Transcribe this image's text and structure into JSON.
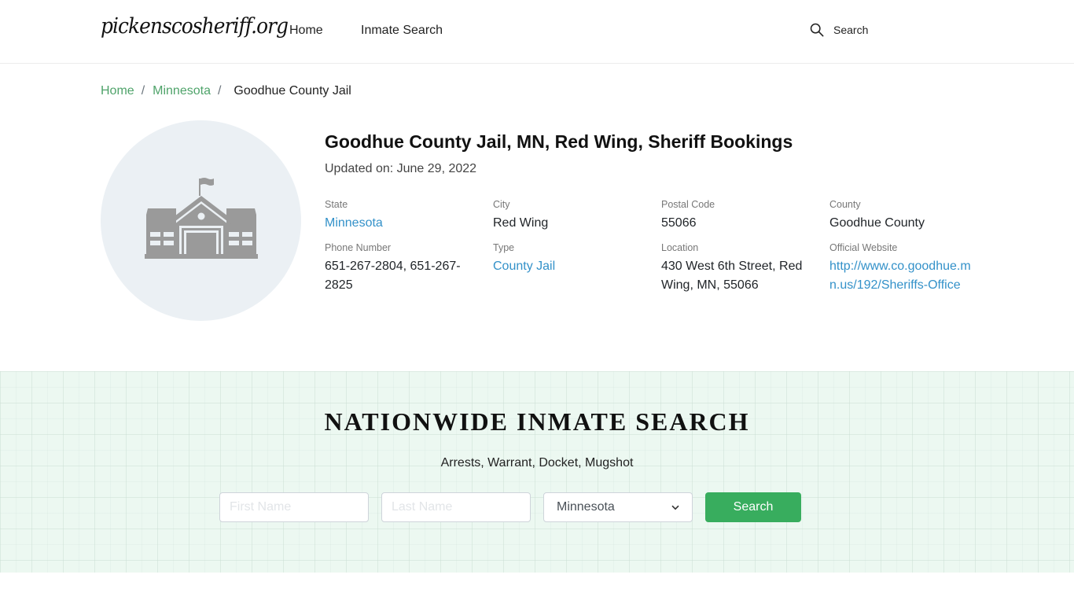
{
  "header": {
    "logo": "pickenscosheriff.org",
    "nav": [
      {
        "label": "Home"
      },
      {
        "label": "Inmate Search"
      }
    ],
    "search_label": "Search",
    "search_icon": "search-icon"
  },
  "breadcrumb": {
    "items": [
      {
        "label": "Home"
      },
      {
        "label": "Minnesota"
      }
    ],
    "separator": "/",
    "current": "Goodhue County Jail"
  },
  "facility": {
    "icon": "building-icon",
    "title": "Goodhue County Jail, MN, Red Wing, Sheriff Bookings",
    "updated": "Updated on: June 29, 2022",
    "fields": [
      {
        "label": "State",
        "value": "Minnesota",
        "is_link": true
      },
      {
        "label": "City",
        "value": "Red Wing",
        "is_link": false
      },
      {
        "label": "Postal Code",
        "value": "55066",
        "is_link": false
      },
      {
        "label": "County",
        "value": "Goodhue County",
        "is_link": false
      },
      {
        "label": "Phone Number",
        "value": "651-267-2804, 651-267-2825",
        "is_link": false
      },
      {
        "label": "Type",
        "value": "County Jail",
        "is_link": true
      },
      {
        "label": "Location",
        "value": "430 West 6th Street, Red Wing, MN, 55066",
        "is_link": false
      },
      {
        "label": "Official Website",
        "value": "http://www.co.goodhue.mn.us/192/Sheriffs-Office",
        "is_link": true
      }
    ]
  },
  "nationwide_search": {
    "title": "NATIONWIDE INMATE SEARCH",
    "subtitle": "Arrests, Warrant, Docket, Mugshot",
    "first_name_placeholder": "First Name",
    "first_name_value": "",
    "last_name_placeholder": "Last Name",
    "last_name_value": "",
    "state_selected": "Minnesota",
    "button_label": "Search"
  },
  "colors": {
    "link_green": "#4fa36a",
    "link_blue": "#3391c9",
    "button_green": "#38ad5e",
    "section_bg": "#ecf8f1",
    "avatar_bg": "#ebf0f4",
    "icon_gray": "#9a9a9a"
  }
}
